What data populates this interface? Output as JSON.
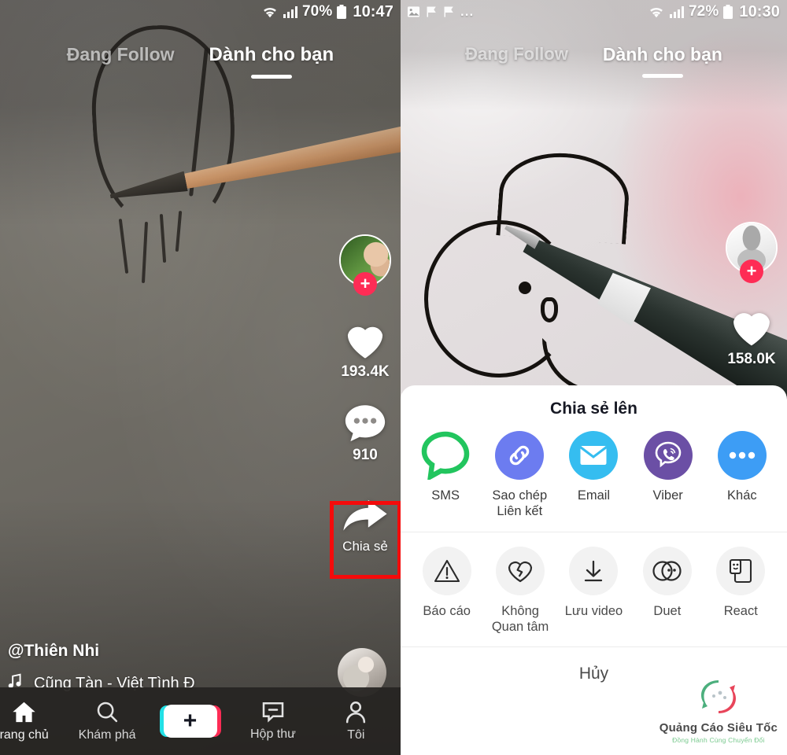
{
  "left_phone": {
    "status_bar": {
      "wifi_icon": "wifi-icon",
      "signal_icon": "signal-bars-icon",
      "battery_percent": "70%",
      "battery_icon": "battery-icon",
      "time": "10:47"
    },
    "tabs": [
      {
        "label": "Đang Follow",
        "active": false
      },
      {
        "label": "Dành cho bạn",
        "active": true
      }
    ],
    "rail": {
      "avatar_plus_badge": "+",
      "like_icon": "heart-icon",
      "like_count": "193.4K",
      "comment_icon": "comment-icon",
      "comment_count": "910",
      "share_icon": "share-arrow-icon",
      "share_label": "Chia sẻ"
    },
    "caption": {
      "username": "@Thiên Nhi",
      "music_icon": "music-note-icon",
      "music": "Cũng Tàn - Việt   Tình Đ"
    },
    "bottom_nav": [
      {
        "label": "rang chủ",
        "icon": "home-icon"
      },
      {
        "label": "Khám phá",
        "icon": "search-icon"
      },
      {
        "label": "+",
        "icon": "plus-create-icon"
      },
      {
        "label": "Hộp thư",
        "icon": "inbox-icon"
      },
      {
        "label": "Tôi",
        "icon": "profile-person-icon"
      }
    ]
  },
  "right_phone": {
    "status_bar": {
      "notif_icons": [
        "image-icon",
        "flag-icon",
        "flag-icon"
      ],
      "overflow": "...",
      "wifi_icon": "wifi-icon",
      "signal_icon": "signal-bars-icon",
      "battery_percent": "72%",
      "battery_icon": "battery-icon",
      "time": "10:30"
    },
    "tabs": [
      {
        "label": "Đang Follow",
        "active": false
      },
      {
        "label": "Dành cho bạn",
        "active": true
      }
    ],
    "rail": {
      "avatar_plus_badge": "+",
      "like_icon": "heart-icon",
      "like_count": "158.0K"
    },
    "share_sheet": {
      "title": "Chia sẻ lên",
      "apps": [
        {
          "label": "SMS",
          "icon": "sms-bubble-icon",
          "color": "#22c55e"
        },
        {
          "label": "Sao chép\nLiên kết",
          "label_line1": "Sao chép",
          "label_line2": "Liên kết",
          "icon": "link-chain-icon",
          "color": "#6c7cf0"
        },
        {
          "label": "Email",
          "icon": "envelope-icon",
          "color": "#35bdf0"
        },
        {
          "label": "Viber",
          "icon": "viber-phone-icon",
          "color": "#6b4fa5"
        },
        {
          "label": "Khác",
          "icon": "more-dots-icon",
          "color": "#3d9df5"
        }
      ],
      "actions": [
        {
          "label": "Báo cáo",
          "icon": "warning-triangle-icon"
        },
        {
          "label": "Không\nQuan tâm",
          "label_line1": "Không",
          "label_line2": "Quan tâm",
          "icon": "broken-heart-icon"
        },
        {
          "label": "Lưu video",
          "icon": "download-arrow-icon"
        },
        {
          "label": "Duet",
          "icon": "duet-circles-icon"
        },
        {
          "label": "React",
          "icon": "react-frames-icon"
        }
      ],
      "cancel_label": "Hủy"
    },
    "watermark": {
      "brand": "Quảng Cáo Siêu Tốc",
      "tagline": "Đồng Hành Cùng Chuyển Đổi",
      "logo_icon": "swirl-logo-icon",
      "colors": {
        "green": "#4caf7d",
        "red": "#e8455a"
      }
    }
  },
  "annotations": {
    "highlight_color": "#f40b0b",
    "boxes": [
      {
        "name": "share-button-highlight",
        "target": "Chia sẻ"
      },
      {
        "name": "copy-link-highlight",
        "target": "Sao chép Liên kết"
      }
    ]
  }
}
